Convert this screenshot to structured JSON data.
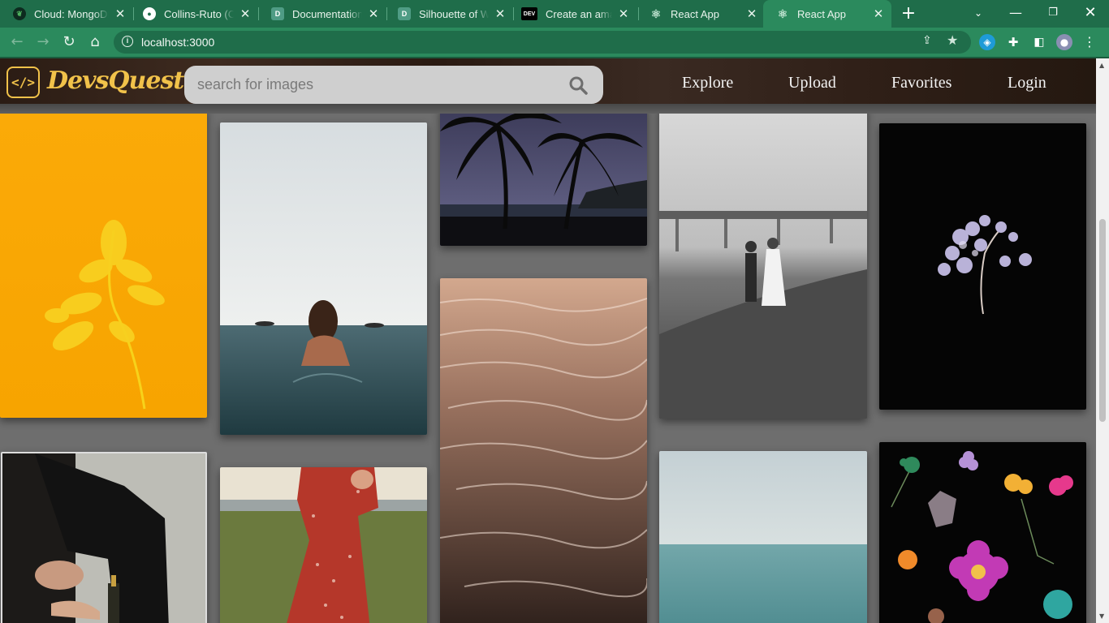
{
  "browser": {
    "tabs": [
      {
        "title": "Cloud: MongoDB",
        "favicon": "mongodb-leaf-icon",
        "active": false
      },
      {
        "title": "Collins-Ruto (Col",
        "favicon": "github-icon",
        "active": false
      },
      {
        "title": "Documentation F",
        "favicon": "docs-icon",
        "active": false
      },
      {
        "title": "Silhouette of Wo",
        "favicon": "docs-icon",
        "active": false
      },
      {
        "title": "Create an amazin",
        "favicon": "dev-icon",
        "active": false
      },
      {
        "title": "React App",
        "favicon": "react-icon",
        "active": false
      },
      {
        "title": "React App",
        "favicon": "react-icon",
        "active": true
      }
    ],
    "dev_favicon_text": "DEV",
    "url": "localhost:3000",
    "colors": {
      "tabbar": "#1f6d4a",
      "toolbar": "#2b8a5d"
    }
  },
  "site": {
    "logo_symbol": "</>",
    "brand": "DevsQuest",
    "search_placeholder": "search for images",
    "nav": {
      "explore": "Explore",
      "upload": "Upload",
      "favorites": "Favorites",
      "login": "Login"
    },
    "accent": "#f1c24a"
  },
  "gallery": [
    {
      "subject": "yellow leaf on orange background"
    },
    {
      "subject": "woman swimming in the sea"
    },
    {
      "subject": "palm trees silhouette at dusk"
    },
    {
      "subject": "sunlight reflecting on water"
    },
    {
      "subject": "couple walking on rocky beach under bridge"
    },
    {
      "subject": "pressed lilac flower on black"
    },
    {
      "subject": "person putting on sandals"
    },
    {
      "subject": "woman in red polka dot dress in field"
    },
    {
      "subject": "calm sea horizon"
    },
    {
      "subject": "pressed colorful flowers on black"
    }
  ]
}
